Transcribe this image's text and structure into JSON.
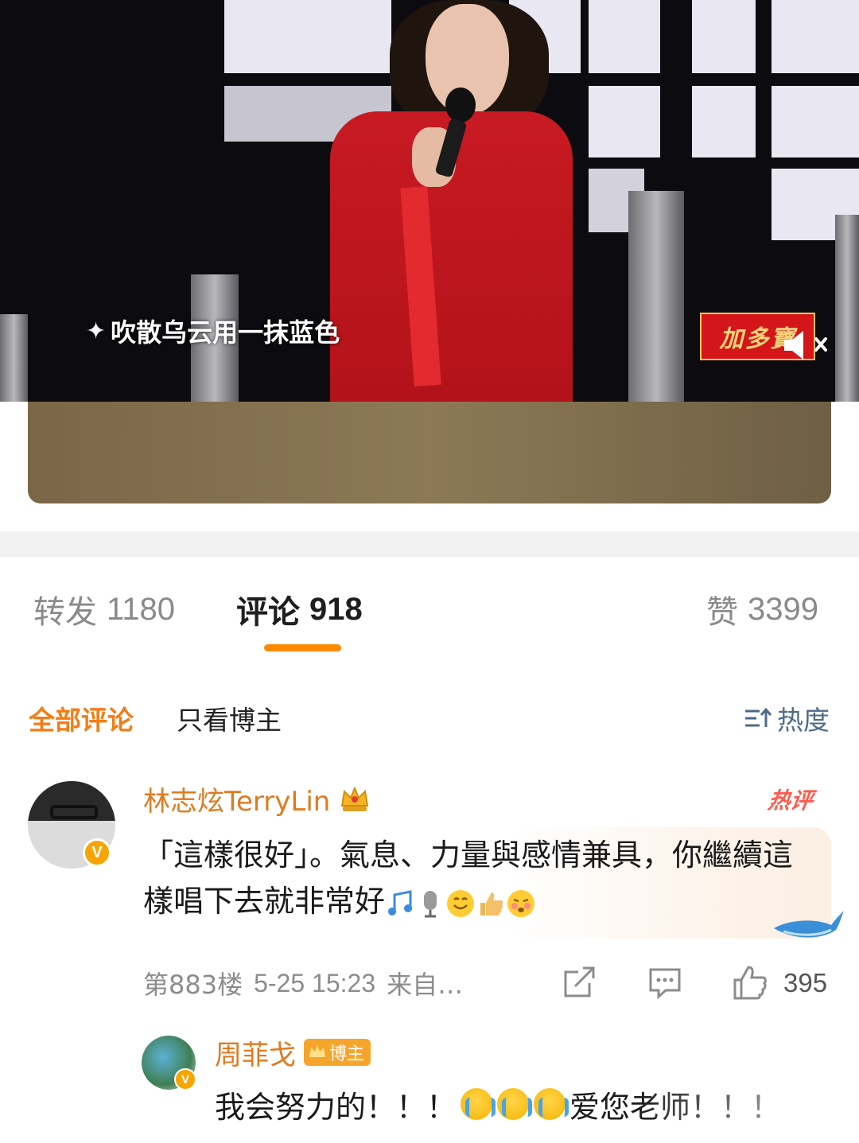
{
  "video": {
    "lyric": "吹散乌云用一抹蓝色",
    "lyric_star": "✦",
    "brand_logo": "加多寶"
  },
  "tabs": [
    {
      "label": "转发",
      "count": "1180",
      "active": false
    },
    {
      "label": "评论",
      "count": "918",
      "active": true
    },
    {
      "label": "赞",
      "count": "3399",
      "active": false
    }
  ],
  "filters": {
    "all": "全部评论",
    "blogger_only": "只看博主",
    "sort": "热度"
  },
  "comment": {
    "username": "林志炫TerryLin",
    "hot_tag": "热评",
    "text": "「這樣很好」。氣息、力量與感情兼具，你繼續這樣唱下去就非常好",
    "emojis": [
      "music-note",
      "microphone",
      "smile",
      "thumbs-up",
      "blush"
    ],
    "floor": "第883楼",
    "time": "5-25 15:23",
    "source": "来自…",
    "likes": "395"
  },
  "reply": {
    "username": "周菲戈",
    "badge": "博主",
    "text_a": "我会努力的！！！",
    "text_b": "爱您老师！！！"
  },
  "colors": {
    "accent_orange": "#f57c14",
    "username_orange": "#e07a21",
    "tab_indicator": "#ff8a00",
    "hot_red": "#ff5a4e",
    "sort_blue": "#4d6b8a"
  }
}
